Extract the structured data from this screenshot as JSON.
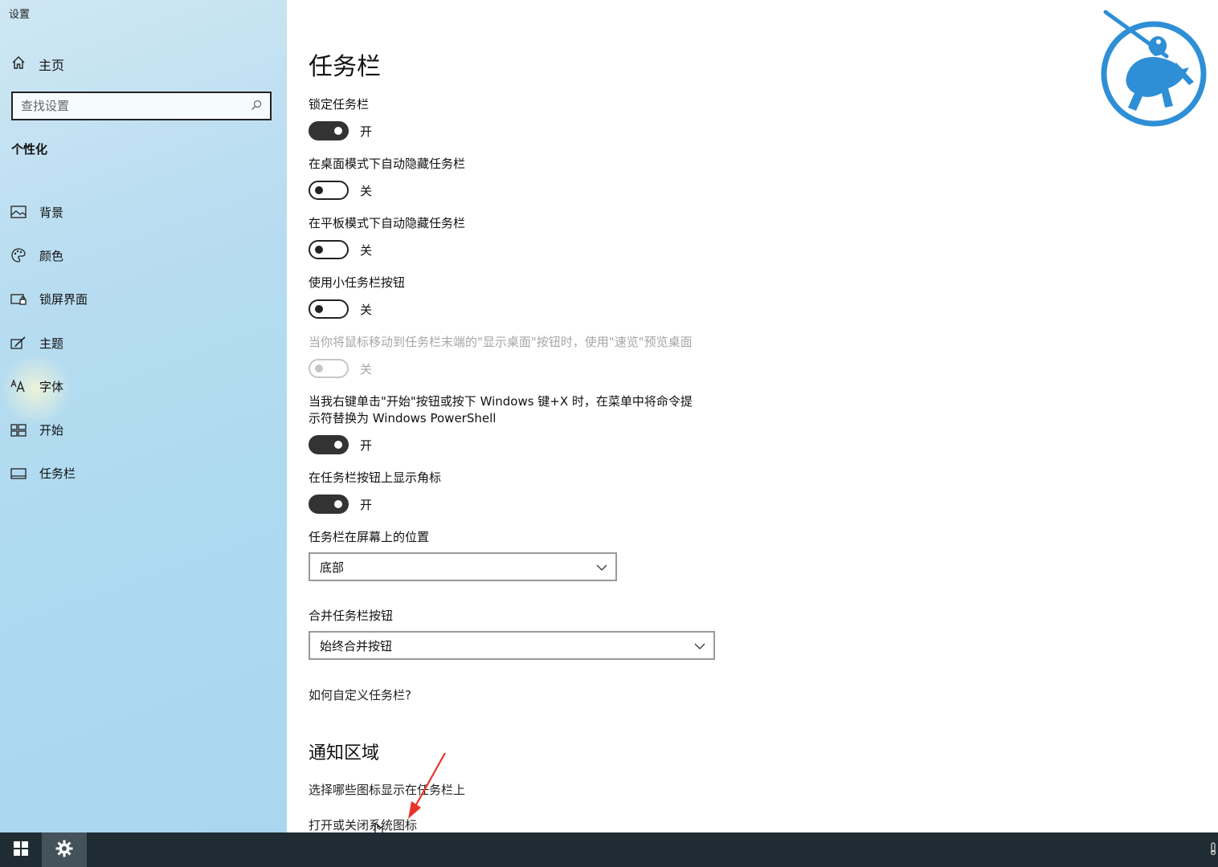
{
  "app": {
    "title": "设置"
  },
  "sidebar": {
    "home_label": "主页",
    "search_placeholder": "查找设置",
    "section": "个性化",
    "items": [
      {
        "label": "背景",
        "icon": "image-icon"
      },
      {
        "label": "颜色",
        "icon": "palette-icon"
      },
      {
        "label": "锁屏界面",
        "icon": "lock-screen-icon"
      },
      {
        "label": "主题",
        "icon": "theme-brush-icon"
      },
      {
        "label": "字体",
        "icon": "font-icon"
      },
      {
        "label": "开始",
        "icon": "start-grid-icon"
      },
      {
        "label": "任务栏",
        "icon": "taskbar-icon"
      }
    ]
  },
  "main": {
    "title": "任务栏",
    "settings": [
      {
        "label": "锁定任务栏",
        "state": "开",
        "on": true
      },
      {
        "label": "在桌面模式下自动隐藏任务栏",
        "state": "关",
        "on": false
      },
      {
        "label": "在平板模式下自动隐藏任务栏",
        "state": "关",
        "on": false
      },
      {
        "label": "使用小任务栏按钮",
        "state": "关",
        "on": false
      },
      {
        "label": "当你将鼠标移动到任务栏末端的\"显示桌面\"按钮时，使用\"速览\"预览桌面",
        "state": "关",
        "on": false,
        "disabled": true
      },
      {
        "label_line1": "当我右键单击\"开始\"按钮或按下 Windows 键+X 时，在菜单中将命令提",
        "label_line2": "示符替换为 Windows PowerShell",
        "state": "开",
        "on": true
      },
      {
        "label": "在任务栏按钮上显示角标",
        "state": "开",
        "on": true
      }
    ],
    "position": {
      "label": "任务栏在屏幕上的位置",
      "value": "底部"
    },
    "combine": {
      "label": "合并任务栏按钮",
      "value": "始终合并按钮"
    },
    "help_link": "如何自定义任务栏?",
    "notification": {
      "title": "通知区域",
      "link1": "选择哪些图标显示在任务栏上",
      "link2": "打开或关闭系统图标"
    }
  },
  "colors": {
    "accent_logo": "#2e8fd6",
    "taskbar_bg": "#1f2c34",
    "toggle_on": "#333333",
    "disabled_text": "#a6a6a6"
  }
}
